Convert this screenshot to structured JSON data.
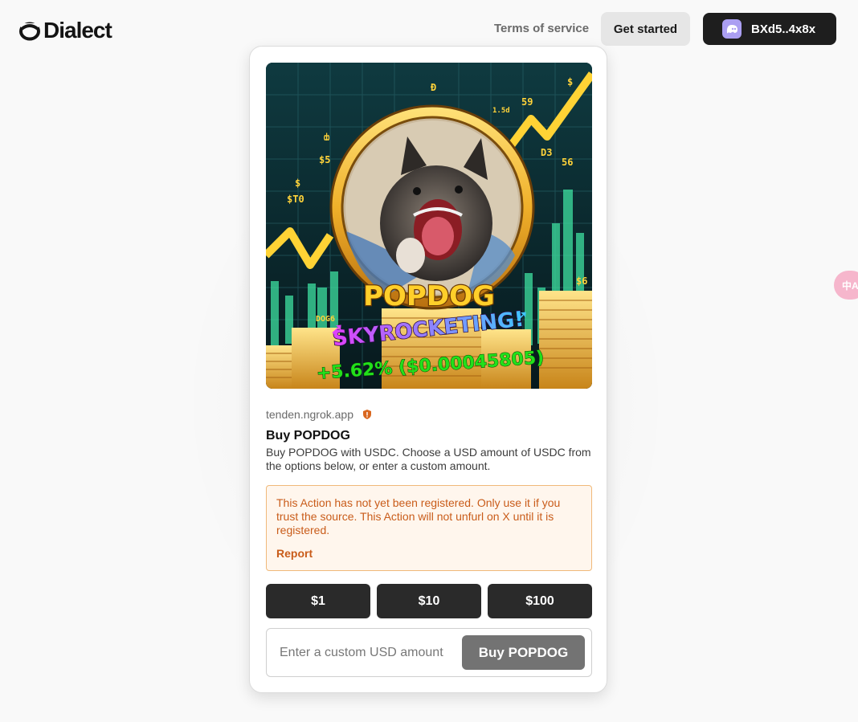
{
  "header": {
    "logo_text": "Dialect",
    "terms_label": "Terms of service",
    "get_started_label": "Get started",
    "wallet_address": "BXd5..4x8x"
  },
  "action": {
    "image": {
      "headline": "POPDOG",
      "subline": "SKYROCKETING!",
      "change": "+5.62% ($0.00045805)",
      "tags": [
        "$",
        "59",
        "D3",
        "56",
        "$5",
        "$T0",
        "56",
        "DOG6",
        "1.5d"
      ]
    },
    "domain": "tenden.ngrok.app",
    "title": "Buy POPDOG",
    "description": "Buy POPDOG with USDC. Choose a USD amount of USDC from the options below, or enter a custom amount.",
    "warning": {
      "text": "This Action has not yet been registered. Only use it if you trust the source. This Action will not unfurl on X until it is registered.",
      "report_label": "Report"
    },
    "amounts": [
      "$1",
      "$10",
      "$100"
    ],
    "custom": {
      "placeholder": "Enter a custom USD amount",
      "button_label": "Buy POPDOG"
    }
  },
  "colors": {
    "primary_button": "#2a2a2a",
    "disabled_button": "#737373",
    "warning_text": "#c95c1a",
    "warning_bg": "#fff6ed",
    "wallet_avatar": "#ab9ff2"
  },
  "icons": [
    "dialect-logo-icon",
    "phantom-ghost-icon",
    "shield-warning-icon",
    "translate-icon"
  ]
}
